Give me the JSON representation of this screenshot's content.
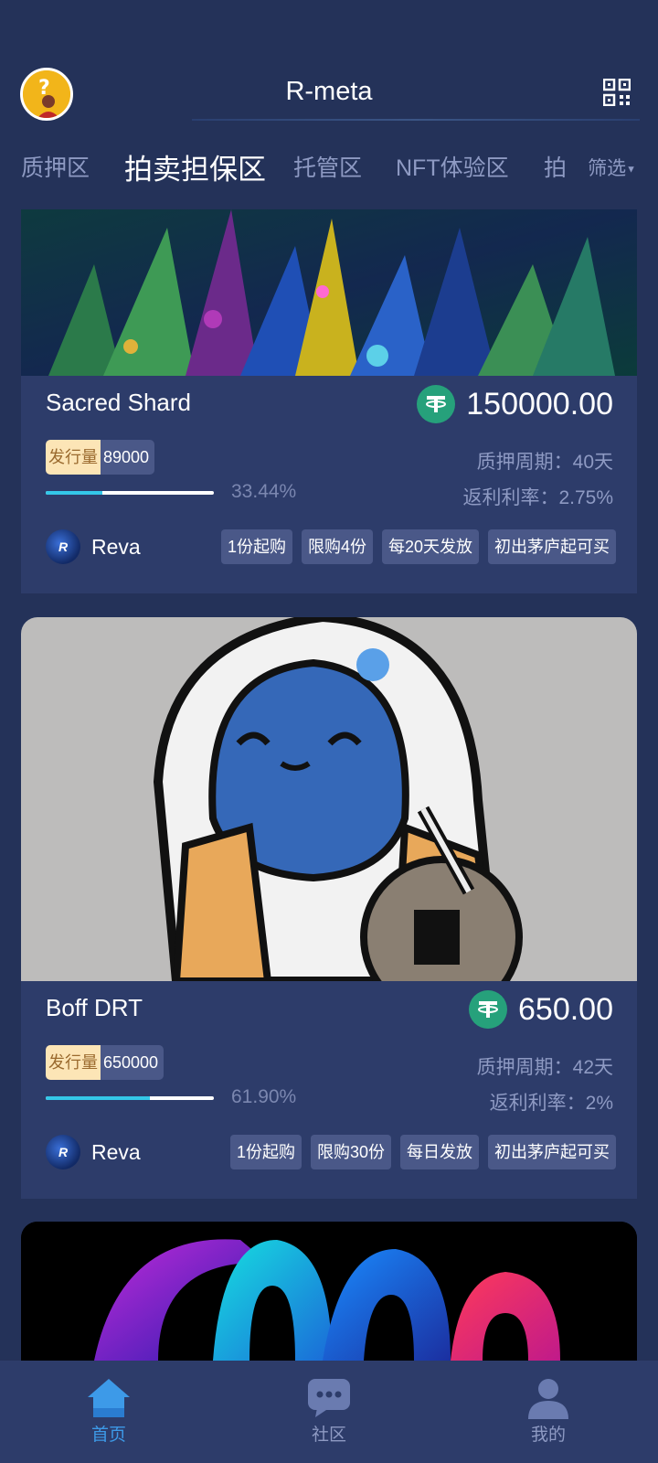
{
  "header": {
    "title": "R-meta"
  },
  "tabs": {
    "items": [
      {
        "label": "质押区"
      },
      {
        "label": "拍卖担保区"
      },
      {
        "label": "托管区"
      },
      {
        "label": "NFT体验区"
      },
      {
        "label": "拍"
      }
    ],
    "active_index": 1,
    "filter_label": "筛选"
  },
  "cards": [
    {
      "name": "Sacred Shard",
      "price": "150000.00",
      "supply_label": "发行量",
      "supply": "89000",
      "progress_pct": 33.44,
      "progress_text": "33.44%",
      "period": "质押周期：40天",
      "rate": "返利利率：2.75%",
      "issuer": "Reva",
      "tags": [
        "1份起购",
        "限购4份",
        "每20天发放",
        "初出茅庐起可买"
      ]
    },
    {
      "name": "Boff DRT",
      "price": "650.00",
      "supply_label": "发行量",
      "supply": "650000",
      "progress_pct": 61.9,
      "progress_text": "61.90%",
      "period": "质押周期：42天",
      "rate": "返利利率：2%",
      "issuer": "Reva",
      "tags": [
        "1份起购",
        "限购30份",
        "每日发放",
        "初出茅庐起可买"
      ]
    }
  ],
  "bottom_nav": [
    {
      "label": "首页",
      "icon": "home-icon",
      "active": true
    },
    {
      "label": "社区",
      "icon": "chat-icon",
      "active": false
    },
    {
      "label": "我的",
      "icon": "user-icon",
      "active": false
    }
  ],
  "colors": {
    "background": "#243259",
    "card": "#2d3c6a",
    "accent_active": "#3d9ae8",
    "progress": "#34c7e8",
    "tether": "#26a17b"
  }
}
